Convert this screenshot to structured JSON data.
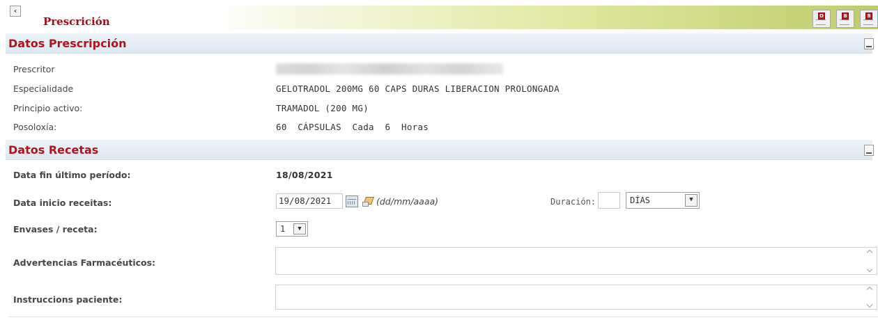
{
  "header": {
    "back_icon": "chevron-left-icon",
    "title": "Prescrición",
    "actions": [
      {
        "name": "report-doc-1-icon",
        "glyph": "D"
      },
      {
        "name": "report-doc-2-icon",
        "glyph": "B"
      },
      {
        "name": "report-doc-3-icon",
        "glyph": "B"
      }
    ]
  },
  "datos_prescripcion": {
    "title": "Datos Prescripción",
    "prescritor_label": "Prescritor",
    "especialidade_label": "Especialidade",
    "especialidade_value": "GELOTRADOL 200MG 60 CAPS DURAS LIBERACION PROLONGADA",
    "principio_label": "Principio activo:",
    "principio_value": "TRAMADOL (200 MG)",
    "posoloxia_label": "Posoloxía:",
    "posoloxia_value": "60  CÁPSULAS  Cada  6  Horas"
  },
  "datos_recetas": {
    "title": "Datos Recetas",
    "fin_label": "Data fin último período:",
    "fin_value": "18/08/2021",
    "inicio_label": "Data inicio receitas:",
    "inicio_value": "19/08/2021",
    "date_format_hint": "(dd/mm/aaaa)",
    "duracion_label": "Duración:",
    "duracion_value": "",
    "duracion_units": "DÍAS",
    "envases_label": "Envases / receta:",
    "envases_value": "1",
    "advertencias_label": "Advertencias Farmacéuticos:",
    "advertencias_value": "",
    "instrucciones_label": "Instruccions paciente:",
    "instrucciones_value": ""
  }
}
